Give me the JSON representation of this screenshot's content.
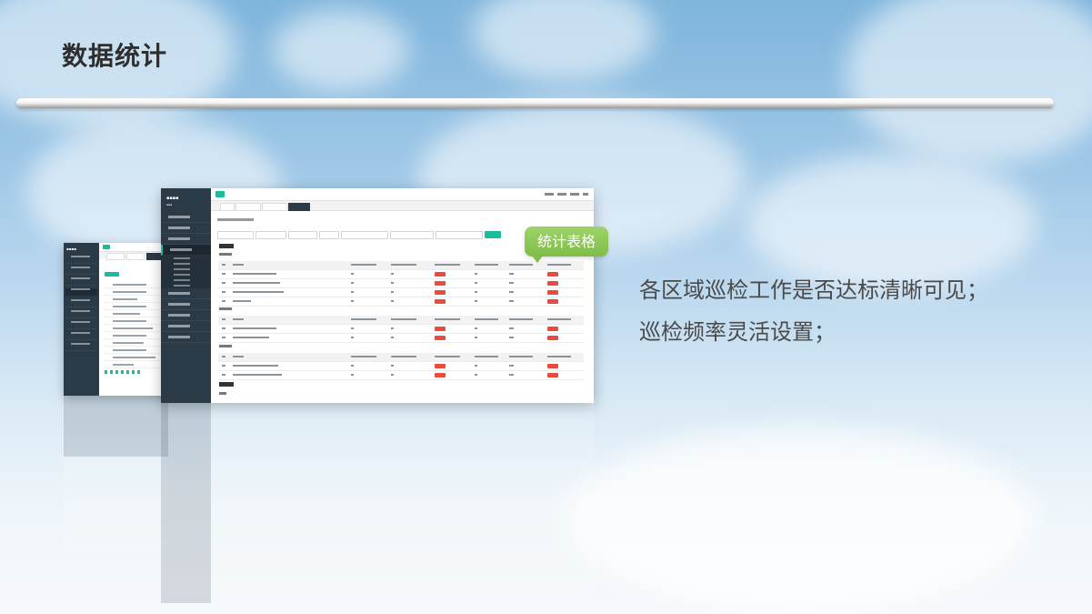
{
  "slide": {
    "title": "数据统计",
    "description_lines": [
      "各区域巡检工作是否达标清晰可见；",
      "巡检频率灵活设置；"
    ],
    "callout_label": "统计表格"
  },
  "colors": {
    "accent_green": "#7fbd47",
    "sidebar": "#2b3a47",
    "teal": "#1abc9c",
    "title_text": "#2e2e2e"
  }
}
